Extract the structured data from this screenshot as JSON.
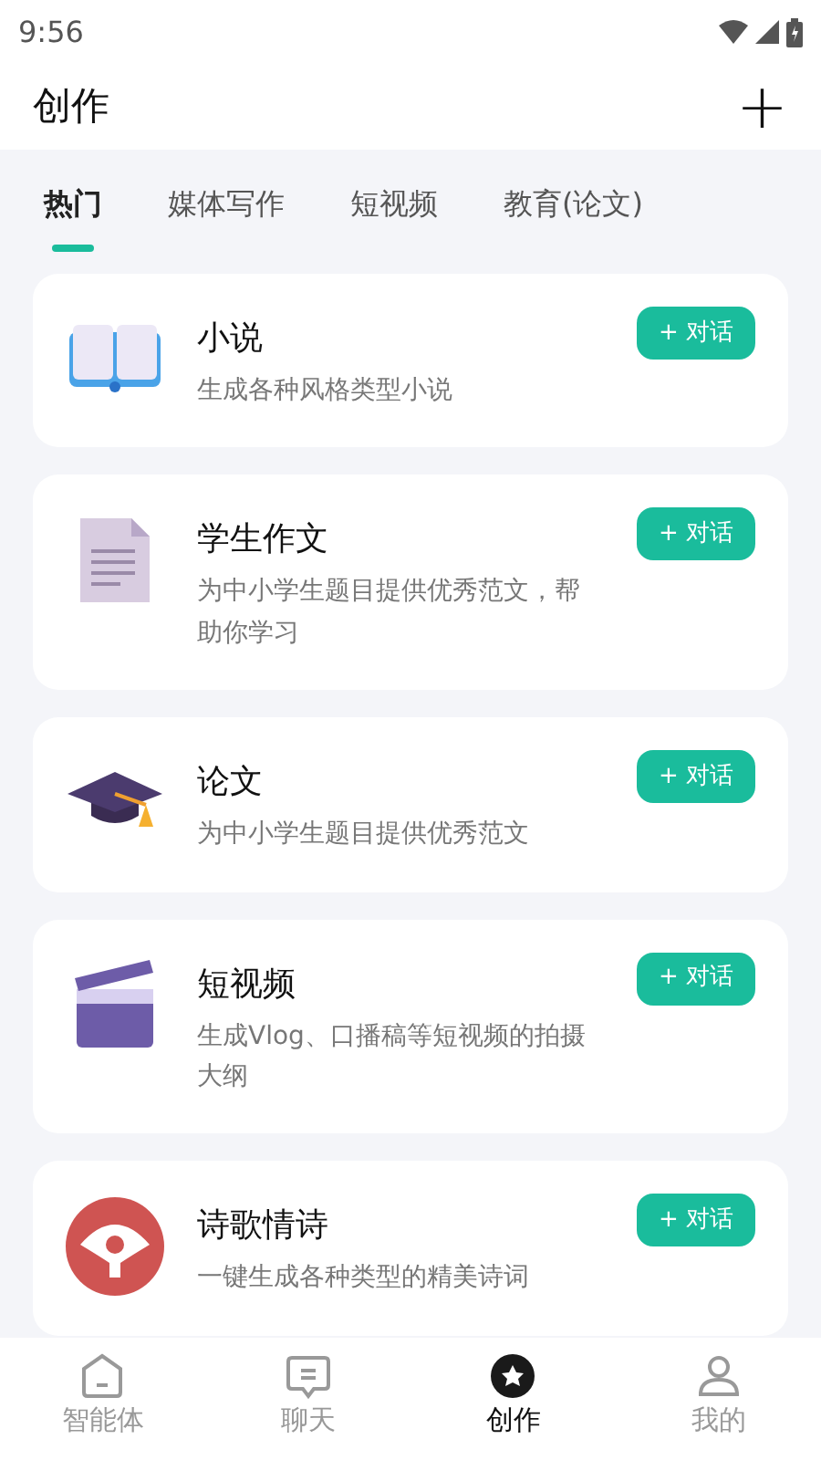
{
  "status_bar": {
    "time": "9:56"
  },
  "header": {
    "title": "创作",
    "add_icon": "+"
  },
  "tabs": [
    {
      "label": "热门",
      "selected": true
    },
    {
      "label": "媒体写作",
      "selected": false
    },
    {
      "label": "短视频",
      "selected": false
    },
    {
      "label": "教育(论文)",
      "selected": false
    }
  ],
  "cards": [
    {
      "kind": "book",
      "title": "小说",
      "description": "生成各种风格类型小说",
      "button": "+ 对话"
    },
    {
      "kind": "document",
      "title": "学生作文",
      "description": "为中小学生题目提供优秀范文，帮助你学习",
      "button": "+ 对话"
    },
    {
      "kind": "cap",
      "title": "论文",
      "description": "为中小学生题目提供优秀范文",
      "button": "+ 对话"
    },
    {
      "kind": "clapper",
      "title": "短视频",
      "description": "生成Vlog、口播稿等短视频的拍摄大纲",
      "button": "+ 对话"
    },
    {
      "kind": "poem",
      "title": "诗歌情诗",
      "description": "一键生成各种类型的精美诗词",
      "button": "+ 对话"
    }
  ],
  "bottom_nav": [
    {
      "kind": "agent",
      "label": "智能体",
      "selected": false
    },
    {
      "kind": "chat",
      "label": "聊天",
      "selected": false
    },
    {
      "kind": "create",
      "label": "创作",
      "selected": true
    },
    {
      "kind": "profile",
      "label": "我的",
      "selected": false
    }
  ]
}
